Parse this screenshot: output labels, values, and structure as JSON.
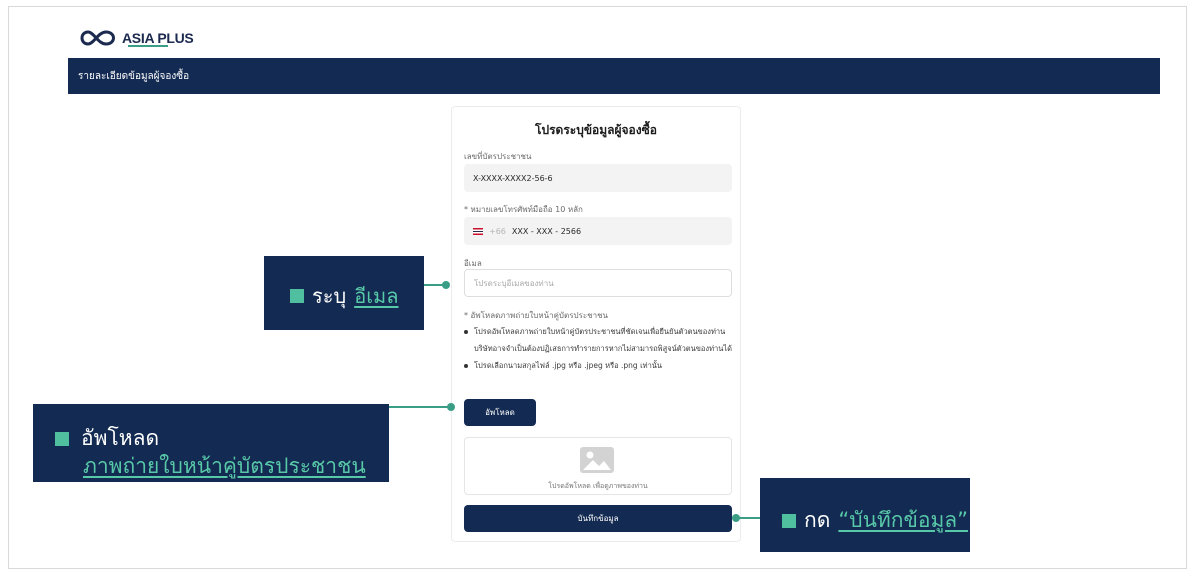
{
  "brand": {
    "logo_text": "ASIA PLUS",
    "accent_color": "#3a9e86",
    "nav_color": "#132a52"
  },
  "navbar": {
    "label": "รายละเอียดข้อมูลผู้จองซื้อ"
  },
  "form": {
    "title": "โปรดระบุข้อมูลผู้จองซื้อ",
    "id_card": {
      "label": "เลขที่บัตรประชาชน",
      "value": "X-XXXX-XXXX2-56-6"
    },
    "phone": {
      "label": "* หมายเลขโทรศัพท์มือถือ 10 หลัก",
      "country_code": "+66",
      "value": "XXX - XXX - 2566"
    },
    "email": {
      "label": "อีเมล",
      "placeholder": "โปรดระบุอีเมลของท่าน"
    },
    "upload": {
      "label": "* อัพโหลดภาพถ่ายใบหน้าคู่บัตรประชาชน",
      "bullets": [
        "โปรดอัพโหลดภาพถ่ายใบหน้าคู่บัตรประชาชนที่ชัดเจนเพื่อยืนยันตัวตนของท่าน บริษัทอาจจำเป็นต้องปฏิเสธการทำรายการหากไม่สามารถพิสูจน์ตัวตนของท่านได้",
        "โปรดเลือกนามสกุลไฟล์ .jpg หรือ .jpeg หรือ .png เท่านั้น"
      ],
      "button_label": "อัพโหลด",
      "drop_text": "โปรดอัพโหลด เพื่อดูภาพของท่าน"
    },
    "save_label": "บันทึกข้อมูล"
  },
  "callouts": {
    "email": {
      "prefix": "ระบุ",
      "highlight": "อีเมล"
    },
    "upload": {
      "line1": "อัพโหลด",
      "highlight": "ภาพถ่ายใบหน้าคู่บัตรประชาชน"
    },
    "save": {
      "prefix": "กด",
      "highlight": "“บันทึกข้อมูล”"
    }
  }
}
